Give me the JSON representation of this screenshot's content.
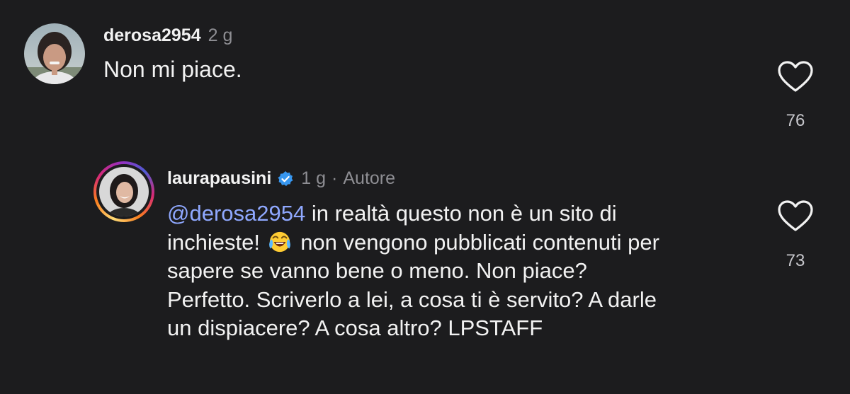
{
  "comments": [
    {
      "username": "derosa2954",
      "time": "2 g",
      "text": "Non mi piace.",
      "likes": "76",
      "icons": {
        "avatar": "user-avatar-photo",
        "like": "heart-outline-icon"
      }
    }
  ],
  "reply": {
    "username": "laurapausini",
    "verified": true,
    "time": "1 g",
    "separator": "·",
    "author_label": "Autore",
    "mention": "@derosa2954",
    "lines": [
      " in realtà questo non è un sito di",
      "inchieste! ",
      " non vengono pubblicati contenuti per",
      "sapere se vanno bene o meno. Non piace?",
      "Perfetto. Scriverlo a lei, a cosa ti è servito? A darle",
      "un dispiacere? A cosa altro? LPSTAFF"
    ],
    "emoji": "face-with-tears-of-joy",
    "likes": "73",
    "colors": {
      "mention": "#8fa8ff",
      "verified": "#3797f0"
    },
    "icons": {
      "avatar": "story-ring-avatar",
      "verified": "verified-badge-icon",
      "like": "heart-outline-icon"
    }
  },
  "colors": {
    "background": "#1c1c1e",
    "text": "#f2f2f2",
    "muted": "#8e8e93"
  }
}
